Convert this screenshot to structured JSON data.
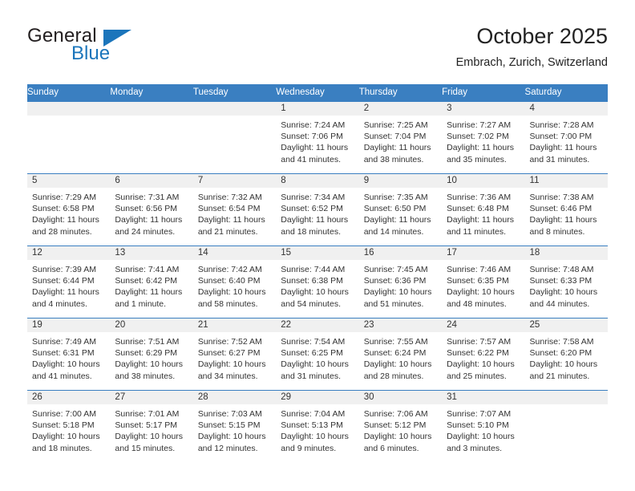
{
  "brand": {
    "name_top": "General",
    "name_bottom": "Blue",
    "triangle_color": "#1b75bb",
    "text_color": "#231f20"
  },
  "header": {
    "title": "October 2025",
    "subtitle": "Embrach, Zurich, Switzerland"
  },
  "theme": {
    "accent": "#3a7fc1",
    "header_text": "#ffffff",
    "daynum_band": "#f0f0f0",
    "cell_text": "#333333"
  },
  "weekday_headers": [
    "Sunday",
    "Monday",
    "Tuesday",
    "Wednesday",
    "Thursday",
    "Friday",
    "Saturday"
  ],
  "weeks": [
    [
      {
        "day": "",
        "empty": true,
        "sunrise": "",
        "sunset": "",
        "daylight_1": "",
        "daylight_2": ""
      },
      {
        "day": "",
        "empty": true,
        "sunrise": "",
        "sunset": "",
        "daylight_1": "",
        "daylight_2": ""
      },
      {
        "day": "",
        "empty": true,
        "sunrise": "",
        "sunset": "",
        "daylight_1": "",
        "daylight_2": ""
      },
      {
        "day": "1",
        "empty": false,
        "sunrise": "Sunrise: 7:24 AM",
        "sunset": "Sunset: 7:06 PM",
        "daylight_1": "Daylight: 11 hours",
        "daylight_2": "and 41 minutes."
      },
      {
        "day": "2",
        "empty": false,
        "sunrise": "Sunrise: 7:25 AM",
        "sunset": "Sunset: 7:04 PM",
        "daylight_1": "Daylight: 11 hours",
        "daylight_2": "and 38 minutes."
      },
      {
        "day": "3",
        "empty": false,
        "sunrise": "Sunrise: 7:27 AM",
        "sunset": "Sunset: 7:02 PM",
        "daylight_1": "Daylight: 11 hours",
        "daylight_2": "and 35 minutes."
      },
      {
        "day": "4",
        "empty": false,
        "sunrise": "Sunrise: 7:28 AM",
        "sunset": "Sunset: 7:00 PM",
        "daylight_1": "Daylight: 11 hours",
        "daylight_2": "and 31 minutes."
      }
    ],
    [
      {
        "day": "5",
        "empty": false,
        "sunrise": "Sunrise: 7:29 AM",
        "sunset": "Sunset: 6:58 PM",
        "daylight_1": "Daylight: 11 hours",
        "daylight_2": "and 28 minutes."
      },
      {
        "day": "6",
        "empty": false,
        "sunrise": "Sunrise: 7:31 AM",
        "sunset": "Sunset: 6:56 PM",
        "daylight_1": "Daylight: 11 hours",
        "daylight_2": "and 24 minutes."
      },
      {
        "day": "7",
        "empty": false,
        "sunrise": "Sunrise: 7:32 AM",
        "sunset": "Sunset: 6:54 PM",
        "daylight_1": "Daylight: 11 hours",
        "daylight_2": "and 21 minutes."
      },
      {
        "day": "8",
        "empty": false,
        "sunrise": "Sunrise: 7:34 AM",
        "sunset": "Sunset: 6:52 PM",
        "daylight_1": "Daylight: 11 hours",
        "daylight_2": "and 18 minutes."
      },
      {
        "day": "9",
        "empty": false,
        "sunrise": "Sunrise: 7:35 AM",
        "sunset": "Sunset: 6:50 PM",
        "daylight_1": "Daylight: 11 hours",
        "daylight_2": "and 14 minutes."
      },
      {
        "day": "10",
        "empty": false,
        "sunrise": "Sunrise: 7:36 AM",
        "sunset": "Sunset: 6:48 PM",
        "daylight_1": "Daylight: 11 hours",
        "daylight_2": "and 11 minutes."
      },
      {
        "day": "11",
        "empty": false,
        "sunrise": "Sunrise: 7:38 AM",
        "sunset": "Sunset: 6:46 PM",
        "daylight_1": "Daylight: 11 hours",
        "daylight_2": "and 8 minutes."
      }
    ],
    [
      {
        "day": "12",
        "empty": false,
        "sunrise": "Sunrise: 7:39 AM",
        "sunset": "Sunset: 6:44 PM",
        "daylight_1": "Daylight: 11 hours",
        "daylight_2": "and 4 minutes."
      },
      {
        "day": "13",
        "empty": false,
        "sunrise": "Sunrise: 7:41 AM",
        "sunset": "Sunset: 6:42 PM",
        "daylight_1": "Daylight: 11 hours",
        "daylight_2": "and 1 minute."
      },
      {
        "day": "14",
        "empty": false,
        "sunrise": "Sunrise: 7:42 AM",
        "sunset": "Sunset: 6:40 PM",
        "daylight_1": "Daylight: 10 hours",
        "daylight_2": "and 58 minutes."
      },
      {
        "day": "15",
        "empty": false,
        "sunrise": "Sunrise: 7:44 AM",
        "sunset": "Sunset: 6:38 PM",
        "daylight_1": "Daylight: 10 hours",
        "daylight_2": "and 54 minutes."
      },
      {
        "day": "16",
        "empty": false,
        "sunrise": "Sunrise: 7:45 AM",
        "sunset": "Sunset: 6:36 PM",
        "daylight_1": "Daylight: 10 hours",
        "daylight_2": "and 51 minutes."
      },
      {
        "day": "17",
        "empty": false,
        "sunrise": "Sunrise: 7:46 AM",
        "sunset": "Sunset: 6:35 PM",
        "daylight_1": "Daylight: 10 hours",
        "daylight_2": "and 48 minutes."
      },
      {
        "day": "18",
        "empty": false,
        "sunrise": "Sunrise: 7:48 AM",
        "sunset": "Sunset: 6:33 PM",
        "daylight_1": "Daylight: 10 hours",
        "daylight_2": "and 44 minutes."
      }
    ],
    [
      {
        "day": "19",
        "empty": false,
        "sunrise": "Sunrise: 7:49 AM",
        "sunset": "Sunset: 6:31 PM",
        "daylight_1": "Daylight: 10 hours",
        "daylight_2": "and 41 minutes."
      },
      {
        "day": "20",
        "empty": false,
        "sunrise": "Sunrise: 7:51 AM",
        "sunset": "Sunset: 6:29 PM",
        "daylight_1": "Daylight: 10 hours",
        "daylight_2": "and 38 minutes."
      },
      {
        "day": "21",
        "empty": false,
        "sunrise": "Sunrise: 7:52 AM",
        "sunset": "Sunset: 6:27 PM",
        "daylight_1": "Daylight: 10 hours",
        "daylight_2": "and 34 minutes."
      },
      {
        "day": "22",
        "empty": false,
        "sunrise": "Sunrise: 7:54 AM",
        "sunset": "Sunset: 6:25 PM",
        "daylight_1": "Daylight: 10 hours",
        "daylight_2": "and 31 minutes."
      },
      {
        "day": "23",
        "empty": false,
        "sunrise": "Sunrise: 7:55 AM",
        "sunset": "Sunset: 6:24 PM",
        "daylight_1": "Daylight: 10 hours",
        "daylight_2": "and 28 minutes."
      },
      {
        "day": "24",
        "empty": false,
        "sunrise": "Sunrise: 7:57 AM",
        "sunset": "Sunset: 6:22 PM",
        "daylight_1": "Daylight: 10 hours",
        "daylight_2": "and 25 minutes."
      },
      {
        "day": "25",
        "empty": false,
        "sunrise": "Sunrise: 7:58 AM",
        "sunset": "Sunset: 6:20 PM",
        "daylight_1": "Daylight: 10 hours",
        "daylight_2": "and 21 minutes."
      }
    ],
    [
      {
        "day": "26",
        "empty": false,
        "sunrise": "Sunrise: 7:00 AM",
        "sunset": "Sunset: 5:18 PM",
        "daylight_1": "Daylight: 10 hours",
        "daylight_2": "and 18 minutes."
      },
      {
        "day": "27",
        "empty": false,
        "sunrise": "Sunrise: 7:01 AM",
        "sunset": "Sunset: 5:17 PM",
        "daylight_1": "Daylight: 10 hours",
        "daylight_2": "and 15 minutes."
      },
      {
        "day": "28",
        "empty": false,
        "sunrise": "Sunrise: 7:03 AM",
        "sunset": "Sunset: 5:15 PM",
        "daylight_1": "Daylight: 10 hours",
        "daylight_2": "and 12 minutes."
      },
      {
        "day": "29",
        "empty": false,
        "sunrise": "Sunrise: 7:04 AM",
        "sunset": "Sunset: 5:13 PM",
        "daylight_1": "Daylight: 10 hours",
        "daylight_2": "and 9 minutes."
      },
      {
        "day": "30",
        "empty": false,
        "sunrise": "Sunrise: 7:06 AM",
        "sunset": "Sunset: 5:12 PM",
        "daylight_1": "Daylight: 10 hours",
        "daylight_2": "and 6 minutes."
      },
      {
        "day": "31",
        "empty": false,
        "sunrise": "Sunrise: 7:07 AM",
        "sunset": "Sunset: 5:10 PM",
        "daylight_1": "Daylight: 10 hours",
        "daylight_2": "and 3 minutes."
      },
      {
        "day": "",
        "empty": true,
        "sunrise": "",
        "sunset": "",
        "daylight_1": "",
        "daylight_2": ""
      }
    ]
  ]
}
